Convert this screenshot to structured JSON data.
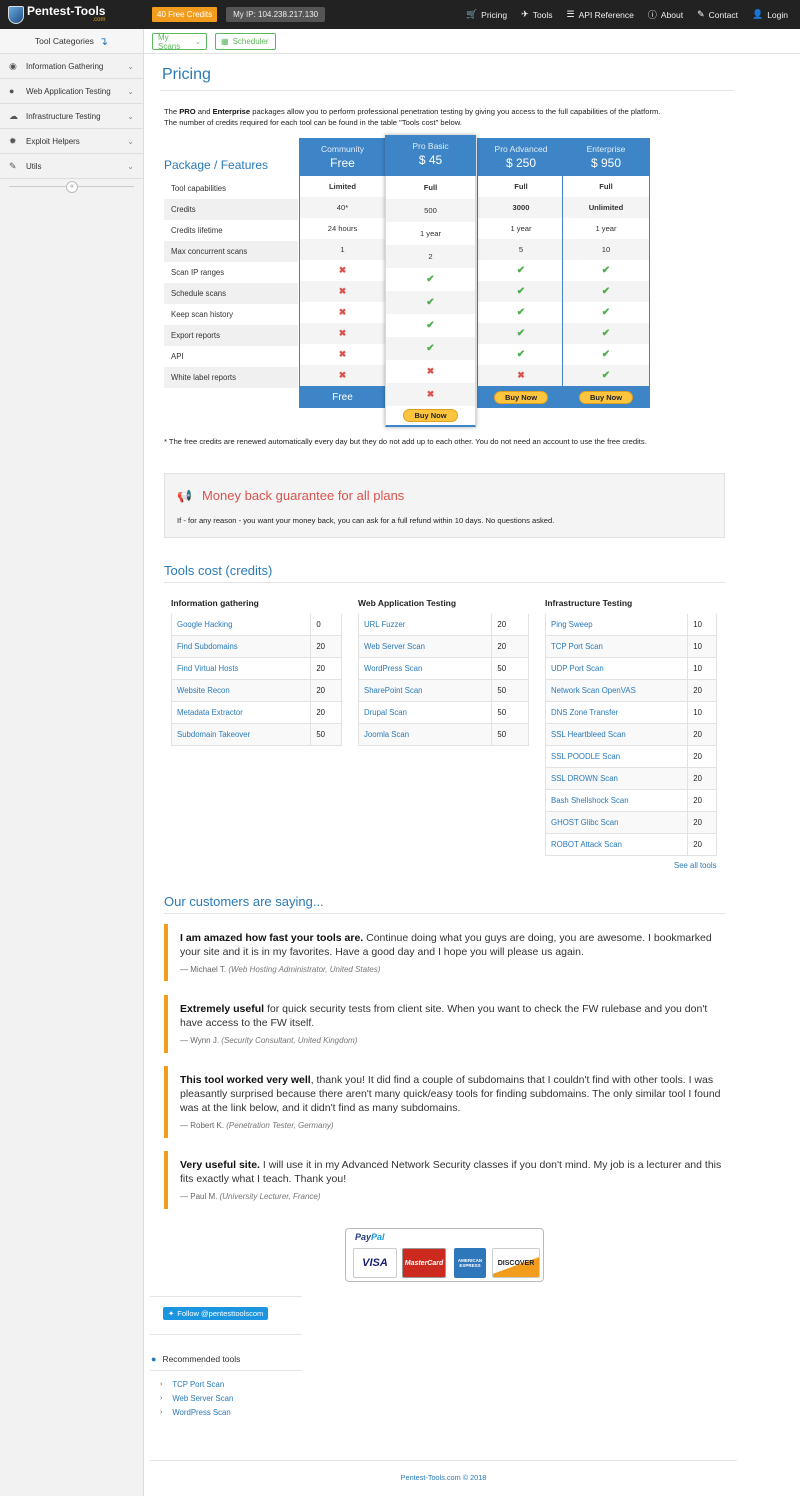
{
  "topnav": {
    "logo": "Pentest-Tools",
    "logo_sub": ".com",
    "credits_badge": "40 Free Credits",
    "my_ip": "My IP:  104.238.217.130",
    "links": [
      {
        "icon": "cart-icon",
        "glyph": "🛒",
        "label": "Pricing"
      },
      {
        "icon": "rocket-icon",
        "glyph": "✈",
        "label": "Tools"
      },
      {
        "icon": "list-icon",
        "glyph": "☰",
        "label": "API Reference"
      },
      {
        "icon": "info-icon",
        "glyph": "ⓘ",
        "label": "About"
      },
      {
        "icon": "edit-icon",
        "glyph": "✎",
        "label": "Contact"
      },
      {
        "icon": "user-icon",
        "glyph": "👤",
        "label": "Login"
      }
    ]
  },
  "sidebar": {
    "title": "Tool Categories",
    "items": [
      {
        "icon": "rss-icon",
        "glyph": "◉",
        "label": "Information Gathering"
      },
      {
        "icon": "globe-icon",
        "glyph": "●",
        "label": "Web Application Testing"
      },
      {
        "icon": "cloud-icon",
        "glyph": "☁",
        "label": "Infrastructure Testing"
      },
      {
        "icon": "bug-icon",
        "glyph": "✹",
        "label": "Exploit Helpers"
      },
      {
        "icon": "wrench-icon",
        "glyph": "✎",
        "label": "Utils"
      }
    ],
    "collapse_glyph": "«"
  },
  "subbar": {
    "my_scans": "My Scans",
    "scheduler": "Scheduler"
  },
  "page": {
    "title": "Pricing",
    "intro_1a": "The ",
    "intro_1b": "PRO",
    "intro_1c": " and ",
    "intro_1d": "Enterprise",
    "intro_1e": " packages allow you to perform professional penetration testing by giving you access to the full capabilities of the platform.",
    "intro_2": "The number of credits required for each tool can be found in the table \"Tools cost\" below."
  },
  "pricing": {
    "label": "Package / Features",
    "features": [
      "Tool capabilities",
      "Credits",
      "Credits lifetime",
      "Max concurrent scans",
      "Scan IP ranges",
      "Schedule scans",
      "Keep scan history",
      "Export reports",
      "API",
      "White label reports"
    ],
    "plans": [
      {
        "name": "Community",
        "price": "Free",
        "values": [
          "Limited",
          "40*",
          "24 hours",
          "1",
          "no",
          "no",
          "no",
          "no",
          "no",
          "no"
        ],
        "footer": "Free"
      },
      {
        "name": "Pro Basic",
        "price": "$ 45",
        "values": [
          "Full",
          "500",
          "1 year",
          "2",
          "yes",
          "yes",
          "yes",
          "yes",
          "no",
          "no"
        ],
        "footer": "Buy Now"
      },
      {
        "name": "Pro Advanced",
        "price": "$ 250",
        "values": [
          "Full",
          "3000",
          "1 year",
          "5",
          "yes",
          "yes",
          "yes",
          "yes",
          "yes",
          "no"
        ],
        "footer": "Buy Now"
      },
      {
        "name": "Enterprise",
        "price": "$ 950",
        "values": [
          "Full",
          "Unlimited",
          "1 year",
          "10",
          "yes",
          "yes",
          "yes",
          "yes",
          "yes",
          "yes"
        ],
        "footer": "Buy Now"
      }
    ],
    "footnote": "* The free credits are renewed automatically every day but they do not add up to each other. You do not need an account to use the free credits."
  },
  "money_back": {
    "title": "Money back guarantee for all plans",
    "text": "If - for any reason - you want your money back, you can ask for a full refund within 10 days. No questions asked."
  },
  "tools_cost": {
    "title": "Tools cost (credits)",
    "groups": [
      {
        "title": "Information gathering",
        "rows": [
          [
            "Google Hacking",
            "0"
          ],
          [
            "Find Subdomains",
            "20"
          ],
          [
            "Find Virtual Hosts",
            "20"
          ],
          [
            "Website Recon",
            "20"
          ],
          [
            "Metadata Extractor",
            "20"
          ],
          [
            "Subdomain Takeover",
            "50"
          ]
        ]
      },
      {
        "title": "Web Application Testing",
        "rows": [
          [
            "URL Fuzzer",
            "20"
          ],
          [
            "Web Server Scan",
            "20"
          ],
          [
            "WordPress Scan",
            "50"
          ],
          [
            "SharePoint Scan",
            "50"
          ],
          [
            "Drupal Scan",
            "50"
          ],
          [
            "Joomla Scan",
            "50"
          ]
        ]
      },
      {
        "title": "Infrastructure Testing",
        "rows": [
          [
            "Ping Sweep",
            "10"
          ],
          [
            "TCP Port Scan",
            "10"
          ],
          [
            "UDP Port Scan",
            "10"
          ],
          [
            "Network Scan OpenVAS",
            "20"
          ],
          [
            "DNS Zone Transfer",
            "10"
          ],
          [
            "SSL Heartbleed Scan",
            "20"
          ],
          [
            "SSL POODLE Scan",
            "20"
          ],
          [
            "SSL DROWN Scan",
            "20"
          ],
          [
            "Bash Shellshock Scan",
            "20"
          ],
          [
            "GHOST Glibc Scan",
            "20"
          ],
          [
            "ROBOT Attack Scan",
            "20"
          ]
        ]
      }
    ],
    "see_all": "See all tools"
  },
  "testimonials": {
    "title": "Our customers are saying...",
    "items": [
      {
        "bold": "I am amazed how fast your tools are.",
        "text": " Continue doing what you guys are doing, you are awesome. I bookmarked your site and it is in my favorites. Have a good day and I hope you will please us again.",
        "author": "Michael T.",
        "role": "(Web Hosting Administrator, United States)"
      },
      {
        "bold": "Extremely useful",
        "text": " for quick security tests from client site. When you want to check the FW rulebase and you don't have access to the FW itself.",
        "author": "Wynn J.",
        "role": "(Security Consultant, United Kingdom)"
      },
      {
        "bold": "This tool worked very well",
        "text": ", thank you! It did find a couple of subdomains that I couldn't find with other tools. I was pleasantly surprised because there aren't many quick/easy tools for finding subdomains. The only similar tool I found was at the link below, and it didn't find as many subdomains.",
        "author": "Robert K.",
        "role": "(Penetration Tester, Germany)"
      },
      {
        "bold": "Very useful site.",
        "text": " I will use it in my Advanced Network Security classes if you don't mind. My job is a lecturer and this fits exactly what I teach. Thank you!",
        "author": "Paul M.",
        "role": "(University Lecturer, France)"
      }
    ]
  },
  "payment": {
    "paypal_a": "Pay",
    "paypal_b": "Pal",
    "cards": [
      "VISA",
      "MasterCard",
      "AMERICAN EXPRESS",
      "DISCOVER"
    ]
  },
  "twitter": {
    "label": "Follow @pentesttoolscom"
  },
  "recommended": {
    "title": "Recommended tools",
    "items": [
      "TCP Port Scan",
      "Web Server Scan",
      "WordPress Scan"
    ]
  },
  "footer": {
    "text": "Pentest-Tools.com © 2018"
  },
  "colors": {
    "accent": "#2a7ab8",
    "plan_blue": "#3d85c6",
    "orange": "#f29c1e",
    "green": "#4cae4c",
    "red": "#d9534f"
  }
}
